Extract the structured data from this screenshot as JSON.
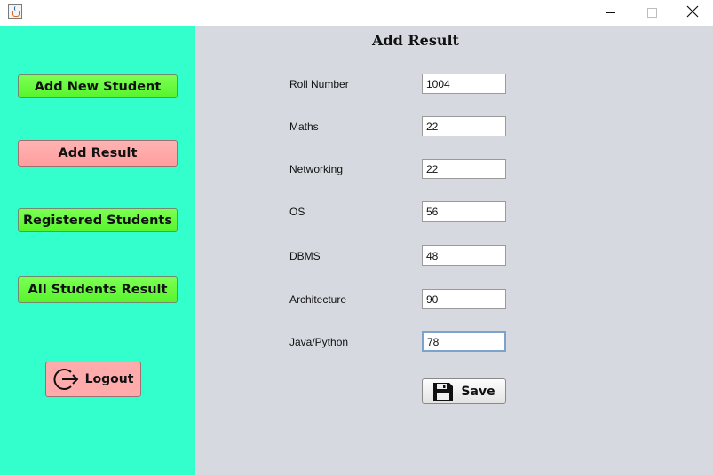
{
  "window": {
    "title_icon": "java-cup-icon",
    "controls": [
      "minimize-icon",
      "maximize-icon",
      "close-icon"
    ]
  },
  "sidebar": {
    "background": "#33ffcc",
    "items": [
      {
        "label": "Add New Student",
        "color": "#57f42c"
      },
      {
        "label": "Add Result",
        "color": "#ff9e9e",
        "active": true
      },
      {
        "label": "Registered Students",
        "color": "#57f42c"
      },
      {
        "label": "All Students Result",
        "color": "#57f42c"
      }
    ],
    "logout": {
      "label": "Logout",
      "icon": "logout-icon",
      "color": "#ffabab"
    }
  },
  "main": {
    "background": "#d6d9df",
    "title": "Add Result",
    "fields": [
      {
        "label": "Roll Number",
        "value": "1004"
      },
      {
        "label": "Maths",
        "value": "22"
      },
      {
        "label": "Networking",
        "value": "22"
      },
      {
        "label": "OS",
        "value": "56"
      },
      {
        "label": "DBMS",
        "value": "48"
      },
      {
        "label": "Architecture",
        "value": "90"
      },
      {
        "label": "Java/Python",
        "value": "78",
        "focused": true
      }
    ],
    "save": {
      "label": "Save",
      "icon": "floppy-disk-icon"
    }
  }
}
